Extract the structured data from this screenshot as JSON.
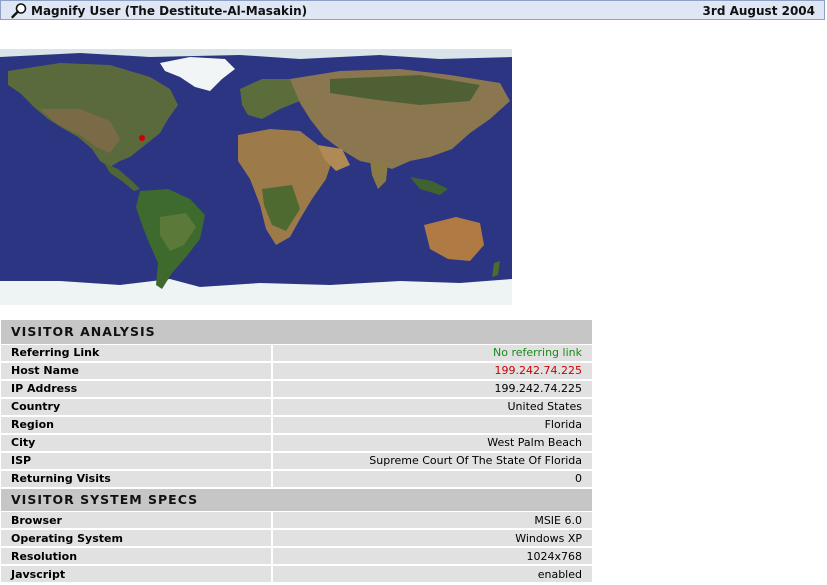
{
  "header": {
    "title": "Magnify User (The Destitute-Al-Masakin)",
    "date": "3rd August 2004"
  },
  "map": {
    "icon": "world-map",
    "marker_color": "#d00000",
    "ocean_color": "#2b3582"
  },
  "visitor_analysis": {
    "heading": "VISITOR ANALYSIS",
    "rows": [
      {
        "label": "Referring Link",
        "value": "No referring link",
        "value_color": "#1a8a1a"
      },
      {
        "label": "Host Name",
        "value": "199.242.74.225",
        "value_color": "#cc0000"
      },
      {
        "label": "IP Address",
        "value": "199.242.74.225"
      },
      {
        "label": "Country",
        "value": "United States"
      },
      {
        "label": "Region",
        "value": "Florida"
      },
      {
        "label": "City",
        "value": "West Palm Beach"
      },
      {
        "label": "ISP",
        "value": "Supreme Court Of The State Of Florida"
      },
      {
        "label": "Returning Visits",
        "value": "0"
      }
    ]
  },
  "visitor_system_specs": {
    "heading": "VISITOR SYSTEM SPECS",
    "rows": [
      {
        "label": "Browser",
        "value": "MSIE 6.0"
      },
      {
        "label": "Operating System",
        "value": "Windows XP"
      },
      {
        "label": "Resolution",
        "value": "1024x768"
      },
      {
        "label": "Javscript",
        "value": "enabled"
      }
    ]
  }
}
